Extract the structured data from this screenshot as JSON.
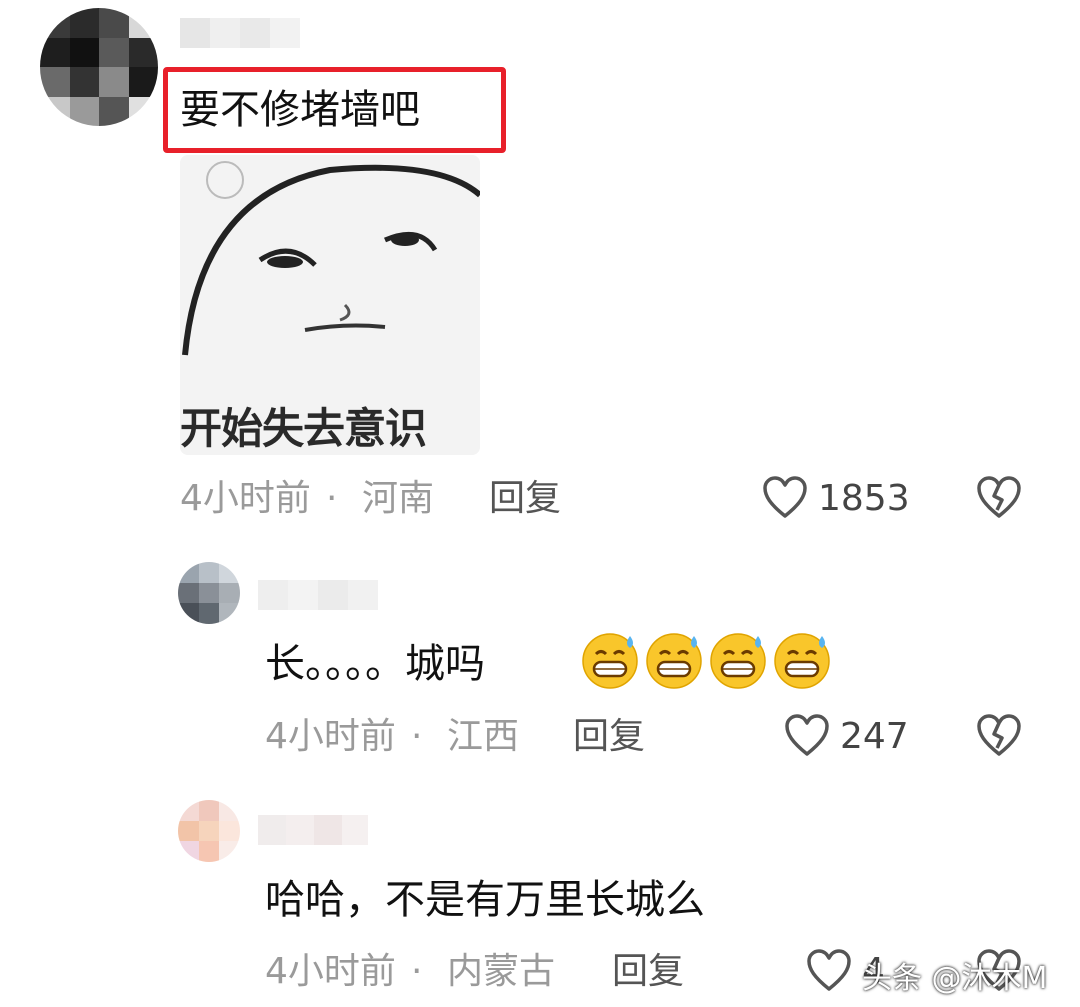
{
  "comments": [
    {
      "text": "要不修堵墙吧",
      "sticker_caption": "开始失去意识",
      "time": "4小时前",
      "separator": "·",
      "location": "河南",
      "reply_label": "回复",
      "likes": "1853"
    },
    {
      "text_prefix": "长。。。。城吗",
      "emoji_name": "grinning-sweat-emoji",
      "emoji_count": 4,
      "time": "4小时前",
      "separator": "·",
      "location": "江西",
      "reply_label": "回复",
      "likes": "247"
    },
    {
      "text": "哈哈，不是有万里长城么",
      "time": "4小时前",
      "separator": "·",
      "location": "内蒙古",
      "reply_label": "回复",
      "likes": "4"
    }
  ],
  "watermark": "头条 @沐木M",
  "colors": {
    "highlight": "#e8202a",
    "meta": "#9a9a9a",
    "text": "#111111"
  }
}
